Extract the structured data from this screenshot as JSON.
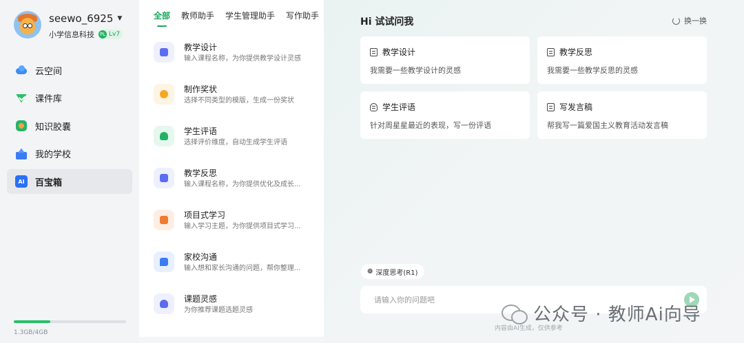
{
  "user": {
    "name": "seewo_6925",
    "org": "小学信息科技",
    "level": "Lv7",
    "level_icon": "PL"
  },
  "nav": {
    "items": [
      {
        "label": "云空间",
        "icon": "cloud-icon"
      },
      {
        "label": "课件库",
        "icon": "courseware-icon"
      },
      {
        "label": "知识胶囊",
        "icon": "knowledge-capsule-icon"
      },
      {
        "label": "我的学校",
        "icon": "school-icon"
      },
      {
        "label": "百宝箱",
        "icon": "ai-toolbox-icon",
        "icon_text": "AI",
        "active": true
      }
    ]
  },
  "storage": {
    "text": "1.3GB/4GB",
    "used_fraction": 0.325
  },
  "tabs": [
    {
      "label": "全部",
      "active": true
    },
    {
      "label": "教师助手"
    },
    {
      "label": "学生管理助手"
    },
    {
      "label": "写作助手"
    }
  ],
  "tools": [
    {
      "title": "教学设计",
      "desc": "输入课程名称，为你提供教学设计灵感",
      "color": "#5b6cf0",
      "bg": "#eef0fd"
    },
    {
      "title": "制作奖状",
      "desc": "选择不同类型的模版，生成一份奖状",
      "color": "#f5a623",
      "bg": "#fdf4e3"
    },
    {
      "title": "学生评语",
      "desc": "选择评价维度，自动生成学生评语",
      "color": "#22b266",
      "bg": "#e6f7ee"
    },
    {
      "title": "教学反思",
      "desc": "输入课程名称，为你提供优化及成长...",
      "color": "#5b6cf0",
      "bg": "#eef0fd"
    },
    {
      "title": "项目式学习",
      "desc": "输入学习主题，为你提供项目式学习...",
      "color": "#f07a2e",
      "bg": "#fdeee4"
    },
    {
      "title": "家校沟通",
      "desc": "输入想和家长沟通的问题，帮你整理...",
      "color": "#3b7cf2",
      "bg": "#e8f0fe"
    },
    {
      "title": "课题灵感",
      "desc": "为你推荐课题选题灵感",
      "color": "#5b6cf0",
      "bg": "#eef0fd"
    }
  ],
  "main": {
    "title": "Hi 试试问我",
    "refresh_label": "换一换",
    "cards": [
      {
        "title": "教学设计",
        "desc": "我需要一些教学设计的灵感",
        "icon": "document-icon"
      },
      {
        "title": "教学反思",
        "desc": "我需要一些教学反思的灵感",
        "icon": "edit-document-icon"
      },
      {
        "title": "学生评语",
        "desc": "针对周星星最近的表现，写一份评语",
        "icon": "person-icon"
      },
      {
        "title": "写发言稿",
        "desc": "帮我写一篇爱国主义教育活动发言稿",
        "icon": "speech-document-icon"
      }
    ],
    "deep_think_label": "深度思考(R1)",
    "input_placeholder": "请输入你的问题吧",
    "disclaimer": "内容由AI生成，仅供参考"
  },
  "watermark": {
    "text": "公众号 · 教师Ai向导"
  }
}
